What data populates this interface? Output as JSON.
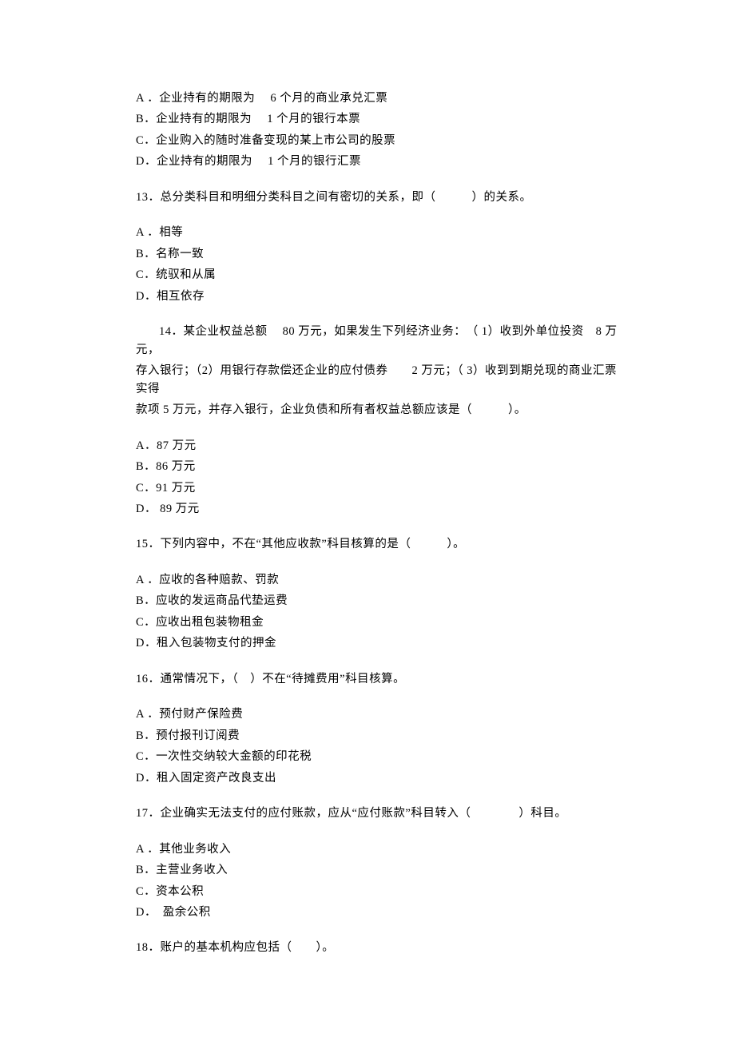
{
  "q12": {
    "options": {
      "A": "A ．企业持有的期限为　 6 个月的商业承兑汇票",
      "B": "B．企业持有的期限为　 1 个月的银行本票",
      "C": "C．企业购入的随时准备变现的某上市公司的股票",
      "D": "D．企业持有的期限为　 1 个月的银行汇票"
    }
  },
  "q13": {
    "stem": "13．总分类科目和明细分类科目之间有密切的关系，即（　　　）的关系。",
    "options": {
      "A": "A ．相等",
      "B": "B．名称一致",
      "C": "C．统驭和从属",
      "D": "D．相互依存"
    }
  },
  "q14": {
    "stem_line1": "14．某企业权益总额　 80 万元，如果发生下列经济业务：　（ 1）收到外单位投资　8 万元，",
    "stem_line2": "存入银行；（2）用银行存款偿还企业的应付债券　　2 万元；（ 3）收到到期兑现的商业汇票实得",
    "stem_line3": "款项 5 万元，并存入银行，企业负债和所有者权益总额应该是（　　　）。",
    "options": {
      "A": "A．87 万元",
      "B": "B．86 万元",
      "C": "C．91 万元",
      "D": "D． 89 万元"
    }
  },
  "q15": {
    "stem": "15．下列内容中，不在“其他应收款”科目核算的是（　　　）。",
    "options": {
      "A": "A ．应收的各种赔款、罚款",
      "B": "B．应收的发运商品代垫运费",
      "C": "C．应收出租包装物租金",
      "D": "D．租入包装物支付的押金"
    }
  },
  "q16": {
    "stem": "16．通常情况下，（　）不在“待摊费用”科目核算。",
    "options": {
      "A": "A ．预付财产保险费",
      "B": "B．预付报刊订阅费",
      "C": "C．一次性交纳较大金额的印花税",
      "D": "D．租入固定资产改良支出"
    }
  },
  "q17": {
    "stem": "17．企业确实无法支付的应付账款，应从“应付账款”科目转入（　　　　）科目。",
    "options": {
      "A": "A ．其他业务收入",
      "B": "B．主营业务收入",
      "C": "C．资本公积",
      "D": "D．　盈余公积"
    }
  },
  "q18": {
    "stem": "18．账户的基本机构应包括（　　）。"
  }
}
